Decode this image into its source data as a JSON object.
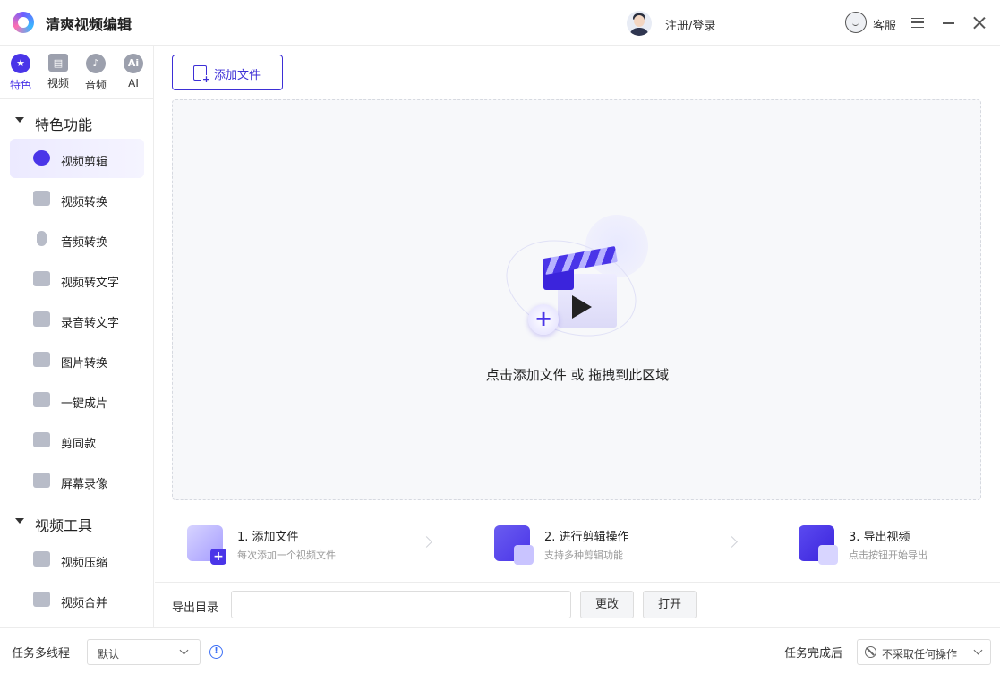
{
  "app": {
    "title": "清爽视频编辑"
  },
  "header": {
    "login": "注册/登录",
    "service": "客服"
  },
  "categories": [
    {
      "label": "特色",
      "icon": "star-icon",
      "active": true
    },
    {
      "label": "视频",
      "icon": "film-icon",
      "active": false
    },
    {
      "label": "音频",
      "icon": "music-icon",
      "active": false
    },
    {
      "label": "AI",
      "icon": "ai-icon",
      "active": false
    }
  ],
  "sidebar": {
    "sections": [
      {
        "title": "特色功能",
        "items": [
          {
            "label": "视频剪辑",
            "active": true
          },
          {
            "label": "视频转换"
          },
          {
            "label": "音频转换"
          },
          {
            "label": "视频转文字"
          },
          {
            "label": "录音转文字"
          },
          {
            "label": "图片转换"
          },
          {
            "label": "一键成片"
          },
          {
            "label": "剪同款"
          },
          {
            "label": "屏幕录像"
          }
        ]
      },
      {
        "title": "视频工具",
        "items": [
          {
            "label": "视频压缩"
          },
          {
            "label": "视频合并"
          }
        ]
      }
    ]
  },
  "main": {
    "add_button": "添加文件",
    "drop_hint": "点击添加文件 或 拖拽到此区域",
    "steps": [
      {
        "title": "1. 添加文件",
        "desc": "每次添加一个视频文件",
        "icon": "add-file-icon"
      },
      {
        "title": "2. 进行剪辑操作",
        "desc": "支持多种剪辑功能",
        "icon": "edit-icon"
      },
      {
        "title": "3. 导出视频",
        "desc": "点击按钮开始导出",
        "icon": "export-icon"
      }
    ],
    "output": {
      "label": "导出目录",
      "value": "",
      "change": "更改",
      "open": "打开"
    }
  },
  "footer": {
    "thread_label": "任务多线程",
    "thread_value": "默认",
    "after_label": "任务完成后",
    "after_value": "不采取任何操作"
  },
  "colors": {
    "accent": "#4a35e8",
    "border": "#ececec",
    "dropzone_bg": "#f7f8fa"
  }
}
